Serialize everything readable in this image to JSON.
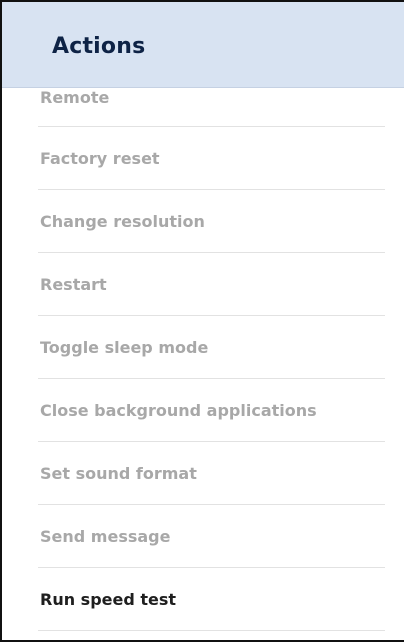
{
  "panel": {
    "title": "Actions"
  },
  "actions": [
    {
      "label": "Remote",
      "enabled": false
    },
    {
      "label": "Factory reset",
      "enabled": false
    },
    {
      "label": "Change resolution",
      "enabled": false
    },
    {
      "label": "Restart",
      "enabled": false
    },
    {
      "label": "Toggle sleep mode",
      "enabled": false
    },
    {
      "label": "Close background applications",
      "enabled": false
    },
    {
      "label": "Set sound format",
      "enabled": false
    },
    {
      "label": "Send message",
      "enabled": false
    },
    {
      "label": "Run speed test",
      "enabled": true
    }
  ],
  "colors": {
    "header_bg": "#d8e3f2",
    "title": "#0e2346",
    "disabled_text": "#a8a8a8",
    "enabled_text": "#1f1f1f"
  }
}
